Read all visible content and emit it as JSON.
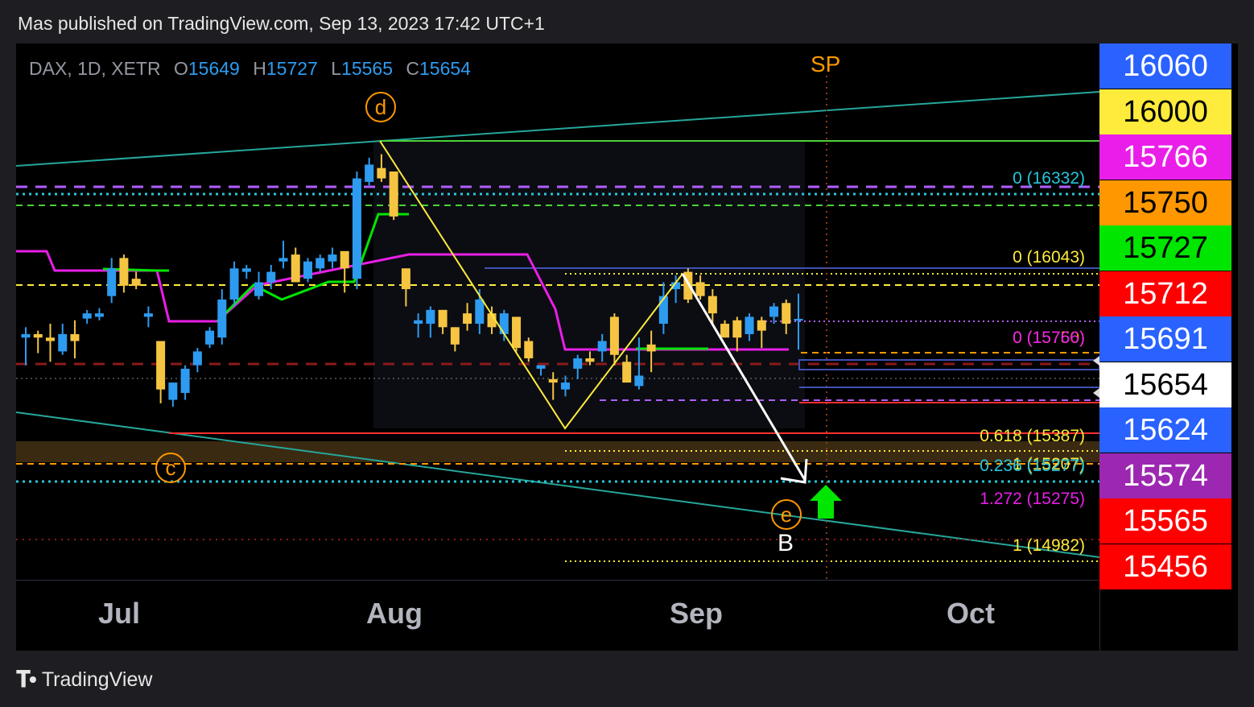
{
  "header": {
    "publisher_line": "Mas published on TradingView.com, Sep 13, 2023 17:42 UTC+1"
  },
  "legend": {
    "symbol": "DAX, 1D, XETR",
    "o_label": "O",
    "o": "15649",
    "h_label": "H",
    "h": "15727",
    "l_label": "L",
    "l": "15565",
    "c_label": "C",
    "c": "15654"
  },
  "price_badges": [
    {
      "label": "16060",
      "bg": "#2962ff",
      "fg": "#ffffff"
    },
    {
      "label": "16000",
      "bg": "#ffeb3b",
      "fg": "#000000"
    },
    {
      "label": "15766",
      "bg": "#e91ee8",
      "fg": "#ffffff"
    },
    {
      "label": "15750",
      "bg": "#ff9800",
      "fg": "#000000"
    },
    {
      "label": "15727",
      "bg": "#00e600",
      "fg": "#000000"
    },
    {
      "label": "15712",
      "bg": "#ff0000",
      "fg": "#ffffff"
    },
    {
      "label": "15691",
      "bg": "#2962ff",
      "fg": "#ffffff"
    },
    {
      "label": "15654",
      "bg": "#ffffff",
      "fg": "#000000"
    },
    {
      "label": "15624",
      "bg": "#2962ff",
      "fg": "#ffffff"
    },
    {
      "label": "15574",
      "bg": "#9c27b0",
      "fg": "#ffffff"
    },
    {
      "label": "15565",
      "bg": "#ff0000",
      "fg": "#ffffff"
    },
    {
      "label": "15456",
      "bg": "#ff0000",
      "fg": "#ffffff"
    }
  ],
  "x_axis": {
    "ticks": [
      "Jul",
      "Aug",
      "Sep",
      "Oct"
    ]
  },
  "fib_labels": [
    {
      "text": "0 (16332)",
      "color": "#26c6da"
    },
    {
      "text": "0 (16043)",
      "color": "#ffeb3b"
    },
    {
      "text": "0 (15750)",
      "color": "#ff9800"
    },
    {
      "text": "0 (15766)",
      "color": "#e91ee8"
    },
    {
      "text": "0.618 (15387)",
      "color": "#ffeb3b"
    },
    {
      "text": "1 (15207)",
      "color": "#ffeb3b"
    },
    {
      "text": "0.236 (15277)",
      "color": "#26c6da"
    },
    {
      "text": "1.272 (15275)",
      "color": "#e91ee8"
    },
    {
      "text": "1 (14982)",
      "color": "#ffeb3b"
    }
  ],
  "annotations": {
    "wave_d": "d",
    "wave_c": "c",
    "wave_e": "e",
    "wave_B": "B",
    "sp_label": "SP"
  },
  "chart_data": {
    "type": "candlestick",
    "symbol": "DAX",
    "interval": "1D",
    "exchange": "XETR",
    "x_ticks": [
      "Jul",
      "Aug",
      "Sep",
      "Oct"
    ],
    "ylim": [
      14900,
      16450
    ],
    "up_color": "#2d9bf0",
    "down_color": "#f5c542",
    "candles": [
      {
        "o": 15600,
        "h": 15630,
        "l": 15520,
        "c": 15610
      },
      {
        "o": 15610,
        "h": 15620,
        "l": 15555,
        "c": 15600
      },
      {
        "o": 15600,
        "h": 15640,
        "l": 15530,
        "c": 15590
      },
      {
        "o": 15560,
        "h": 15640,
        "l": 15550,
        "c": 15610
      },
      {
        "o": 15610,
        "h": 15650,
        "l": 15540,
        "c": 15590
      },
      {
        "o": 15655,
        "h": 15680,
        "l": 15640,
        "c": 15670
      },
      {
        "o": 15660,
        "h": 15685,
        "l": 15650,
        "c": 15670
      },
      {
        "o": 15720,
        "h": 15830,
        "l": 15700,
        "c": 15800
      },
      {
        "o": 15830,
        "h": 15840,
        "l": 15730,
        "c": 15750
      },
      {
        "o": 15770,
        "h": 15790,
        "l": 15740,
        "c": 15750
      },
      {
        "o": 15660,
        "h": 15690,
        "l": 15630,
        "c": 15670
      },
      {
        "o": 15590,
        "h": 15580,
        "l": 15410,
        "c": 15450
      },
      {
        "o": 15420,
        "h": 15470,
        "l": 15400,
        "c": 15470
      },
      {
        "o": 15440,
        "h": 15520,
        "l": 15420,
        "c": 15510
      },
      {
        "o": 15520,
        "h": 15570,
        "l": 15500,
        "c": 15560
      },
      {
        "o": 15580,
        "h": 15630,
        "l": 15570,
        "c": 15620
      },
      {
        "o": 15600,
        "h": 15740,
        "l": 15580,
        "c": 15710
      },
      {
        "o": 15710,
        "h": 15820,
        "l": 15690,
        "c": 15800
      },
      {
        "o": 15790,
        "h": 15810,
        "l": 15770,
        "c": 15800
      },
      {
        "o": 15720,
        "h": 15790,
        "l": 15710,
        "c": 15760
      },
      {
        "o": 15760,
        "h": 15810,
        "l": 15740,
        "c": 15790
      },
      {
        "o": 15820,
        "h": 15880,
        "l": 15800,
        "c": 15830
      },
      {
        "o": 15840,
        "h": 15860,
        "l": 15760,
        "c": 15760
      },
      {
        "o": 15770,
        "h": 15830,
        "l": 15760,
        "c": 15820
      },
      {
        "o": 15800,
        "h": 15840,
        "l": 15790,
        "c": 15830
      },
      {
        "o": 15820,
        "h": 15860,
        "l": 15800,
        "c": 15840
      },
      {
        "o": 15850,
        "h": 15840,
        "l": 15730,
        "c": 15800
      },
      {
        "o": 15770,
        "h": 16080,
        "l": 15740,
        "c": 16060
      },
      {
        "o": 16050,
        "h": 16120,
        "l": 16040,
        "c": 16100
      },
      {
        "o": 16090,
        "h": 16130,
        "l": 16050,
        "c": 16060
      },
      {
        "o": 16080,
        "h": 16080,
        "l": 15940,
        "c": 15950
      },
      {
        "o": 15800,
        "h": 15800,
        "l": 15690,
        "c": 15740
      },
      {
        "o": 15640,
        "h": 15670,
        "l": 15600,
        "c": 15650
      },
      {
        "o": 15640,
        "h": 15690,
        "l": 15600,
        "c": 15680
      },
      {
        "o": 15680,
        "h": 15680,
        "l": 15610,
        "c": 15630
      },
      {
        "o": 15630,
        "h": 15630,
        "l": 15560,
        "c": 15580
      },
      {
        "o": 15670,
        "h": 15700,
        "l": 15620,
        "c": 15640
      },
      {
        "o": 15640,
        "h": 15740,
        "l": 15610,
        "c": 15710
      },
      {
        "o": 15670,
        "h": 15690,
        "l": 15610,
        "c": 15630
      },
      {
        "o": 15610,
        "h": 15680,
        "l": 15590,
        "c": 15670
      },
      {
        "o": 15660,
        "h": 15660,
        "l": 15560,
        "c": 15570
      },
      {
        "o": 15590,
        "h": 15600,
        "l": 15530,
        "c": 15540
      },
      {
        "o": 15510,
        "h": 15520,
        "l": 15490,
        "c": 15520
      },
      {
        "o": 15480,
        "h": 15500,
        "l": 15420,
        "c": 15470
      },
      {
        "o": 15450,
        "h": 15490,
        "l": 15430,
        "c": 15470
      },
      {
        "o": 15510,
        "h": 15550,
        "l": 15480,
        "c": 15540
      },
      {
        "o": 15540,
        "h": 15560,
        "l": 15520,
        "c": 15530
      },
      {
        "o": 15560,
        "h": 15610,
        "l": 15530,
        "c": 15590
      },
      {
        "o": 15660,
        "h": 15670,
        "l": 15520,
        "c": 15550
      },
      {
        "o": 15530,
        "h": 15550,
        "l": 15480,
        "c": 15470
      },
      {
        "o": 15460,
        "h": 15600,
        "l": 15450,
        "c": 15490
      },
      {
        "o": 15580,
        "h": 15620,
        "l": 15500,
        "c": 15560
      },
      {
        "o": 15640,
        "h": 15760,
        "l": 15610,
        "c": 15720
      },
      {
        "o": 15740,
        "h": 15780,
        "l": 15700,
        "c": 15760
      },
      {
        "o": 15790,
        "h": 15800,
        "l": 15700,
        "c": 15710
      },
      {
        "o": 15760,
        "h": 15780,
        "l": 15710,
        "c": 15720
      },
      {
        "o": 15720,
        "h": 15740,
        "l": 15640,
        "c": 15670
      },
      {
        "o": 15640,
        "h": 15650,
        "l": 15610,
        "c": 15600
      },
      {
        "o": 15650,
        "h": 15660,
        "l": 15560,
        "c": 15600
      },
      {
        "o": 15610,
        "h": 15670,
        "l": 15590,
        "c": 15660
      },
      {
        "o": 15650,
        "h": 15660,
        "l": 15570,
        "c": 15620
      },
      {
        "o": 15660,
        "h": 15700,
        "l": 15640,
        "c": 15690
      },
      {
        "o": 15700,
        "h": 15710,
        "l": 15610,
        "c": 15640
      },
      {
        "o": 15649,
        "h": 15727,
        "l": 15565,
        "c": 15654
      }
    ],
    "current_price": 15654
  }
}
